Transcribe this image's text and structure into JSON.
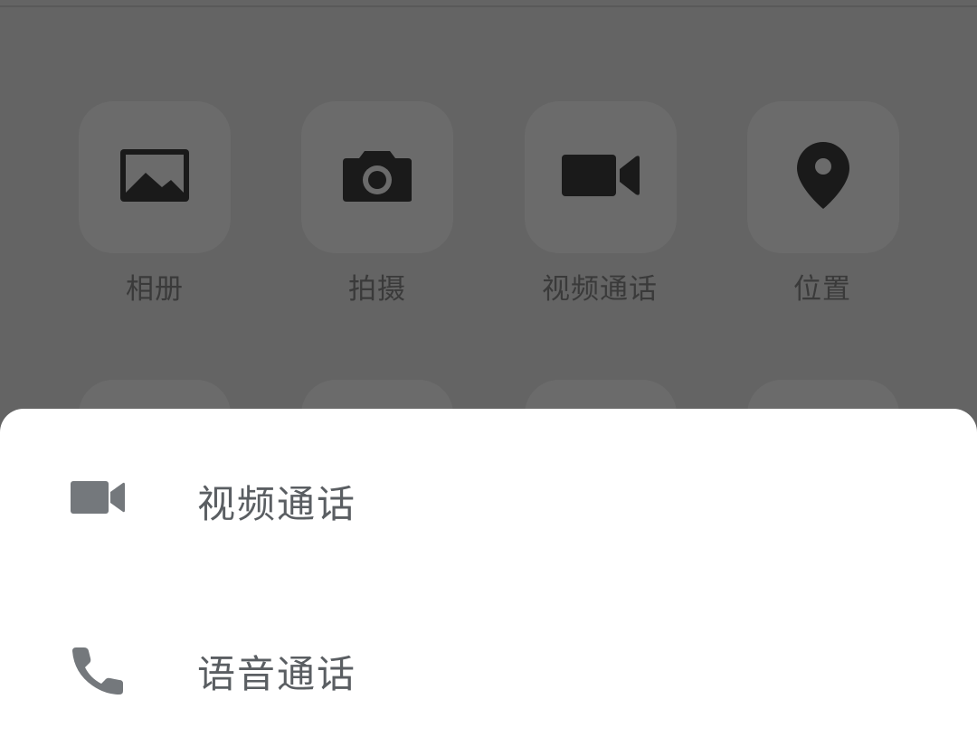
{
  "attachment_panel": {
    "items": [
      {
        "label": "相册",
        "icon": "photo-album-icon"
      },
      {
        "label": "拍摄",
        "icon": "camera-icon"
      },
      {
        "label": "视频通话",
        "icon": "video-call-icon"
      },
      {
        "label": "位置",
        "icon": "location-pin-icon"
      }
    ]
  },
  "call_sheet": {
    "options": [
      {
        "label": "视频通话",
        "icon": "video-camera-icon"
      },
      {
        "label": "语音通话",
        "icon": "phone-icon"
      }
    ]
  },
  "colors": {
    "overlay": "#646464",
    "tile": "#6b6b6b",
    "sheet": "#ffffff",
    "sheet_text": "#5a5e62",
    "icon_dark": "#1a1a1a"
  }
}
